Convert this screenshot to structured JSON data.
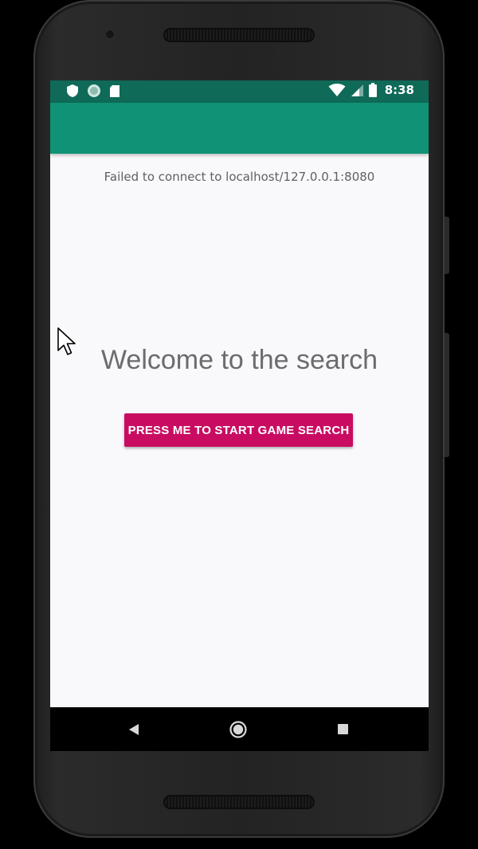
{
  "status_bar": {
    "time": "8:38",
    "left_icons": [
      "shield-icon",
      "sync-circle-icon",
      "sd-card-icon"
    ],
    "right_icons": [
      "wifi-icon",
      "cell-signal-icon",
      "battery-icon"
    ]
  },
  "app_bar": {
    "title": ""
  },
  "main": {
    "error_message": "Failed to connect to localhost/127.0.0.1:8080",
    "welcome_title": "Welcome to the search",
    "start_button_label": "PRESS ME TO START GAME SEARCH"
  },
  "nav_bar": {
    "items": [
      "back-icon",
      "home-icon",
      "recents-icon"
    ]
  },
  "colors": {
    "status_bar": "#0f6a58",
    "app_bar": "#0f9275",
    "accent_button": "#c90c62",
    "screen_background": "#f9f8fb"
  }
}
